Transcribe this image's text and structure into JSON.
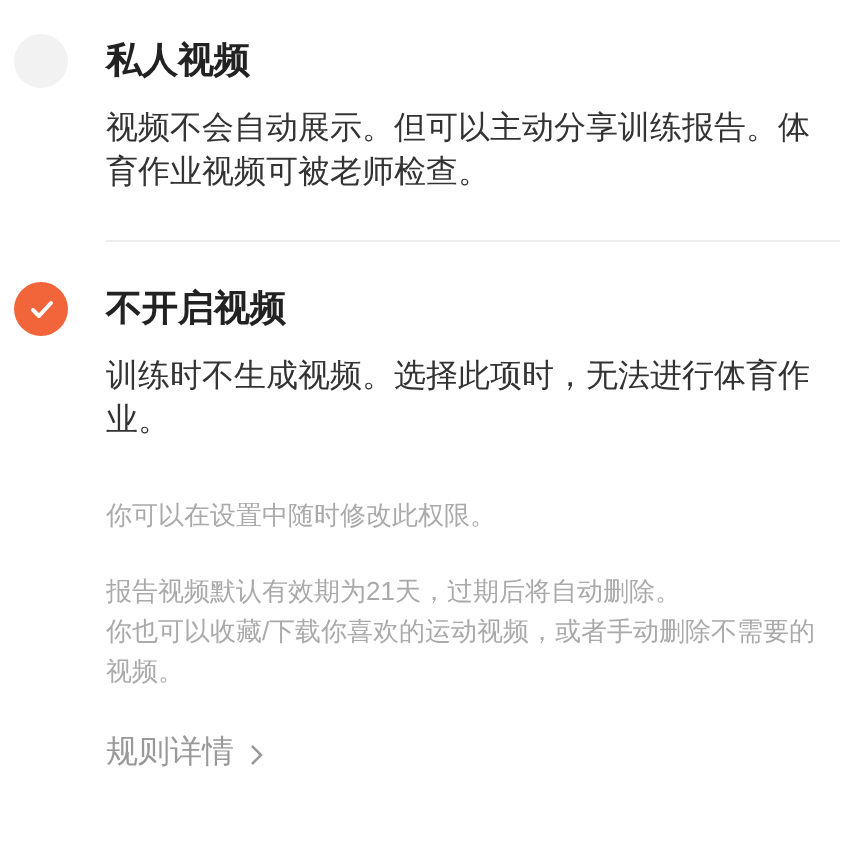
{
  "options": [
    {
      "title": "私人视频",
      "description": "视频不会自动展示。但可以主动分享训练报告。体育作业视频可被老师检查。",
      "selected": false
    },
    {
      "title": "不开启视频",
      "description": "训练时不生成视频。选择此项时，无法进行体育作业。",
      "selected": true
    }
  ],
  "notes": [
    [
      "你可以在设置中随时修改此权限。"
    ],
    [
      "报告视频默认有效期为21天，过期后将自动删除。",
      "你也可以收藏/下载你喜欢的运动视频，或者手动删除不需要的视频。"
    ]
  ],
  "link": {
    "label": "规则详情"
  }
}
